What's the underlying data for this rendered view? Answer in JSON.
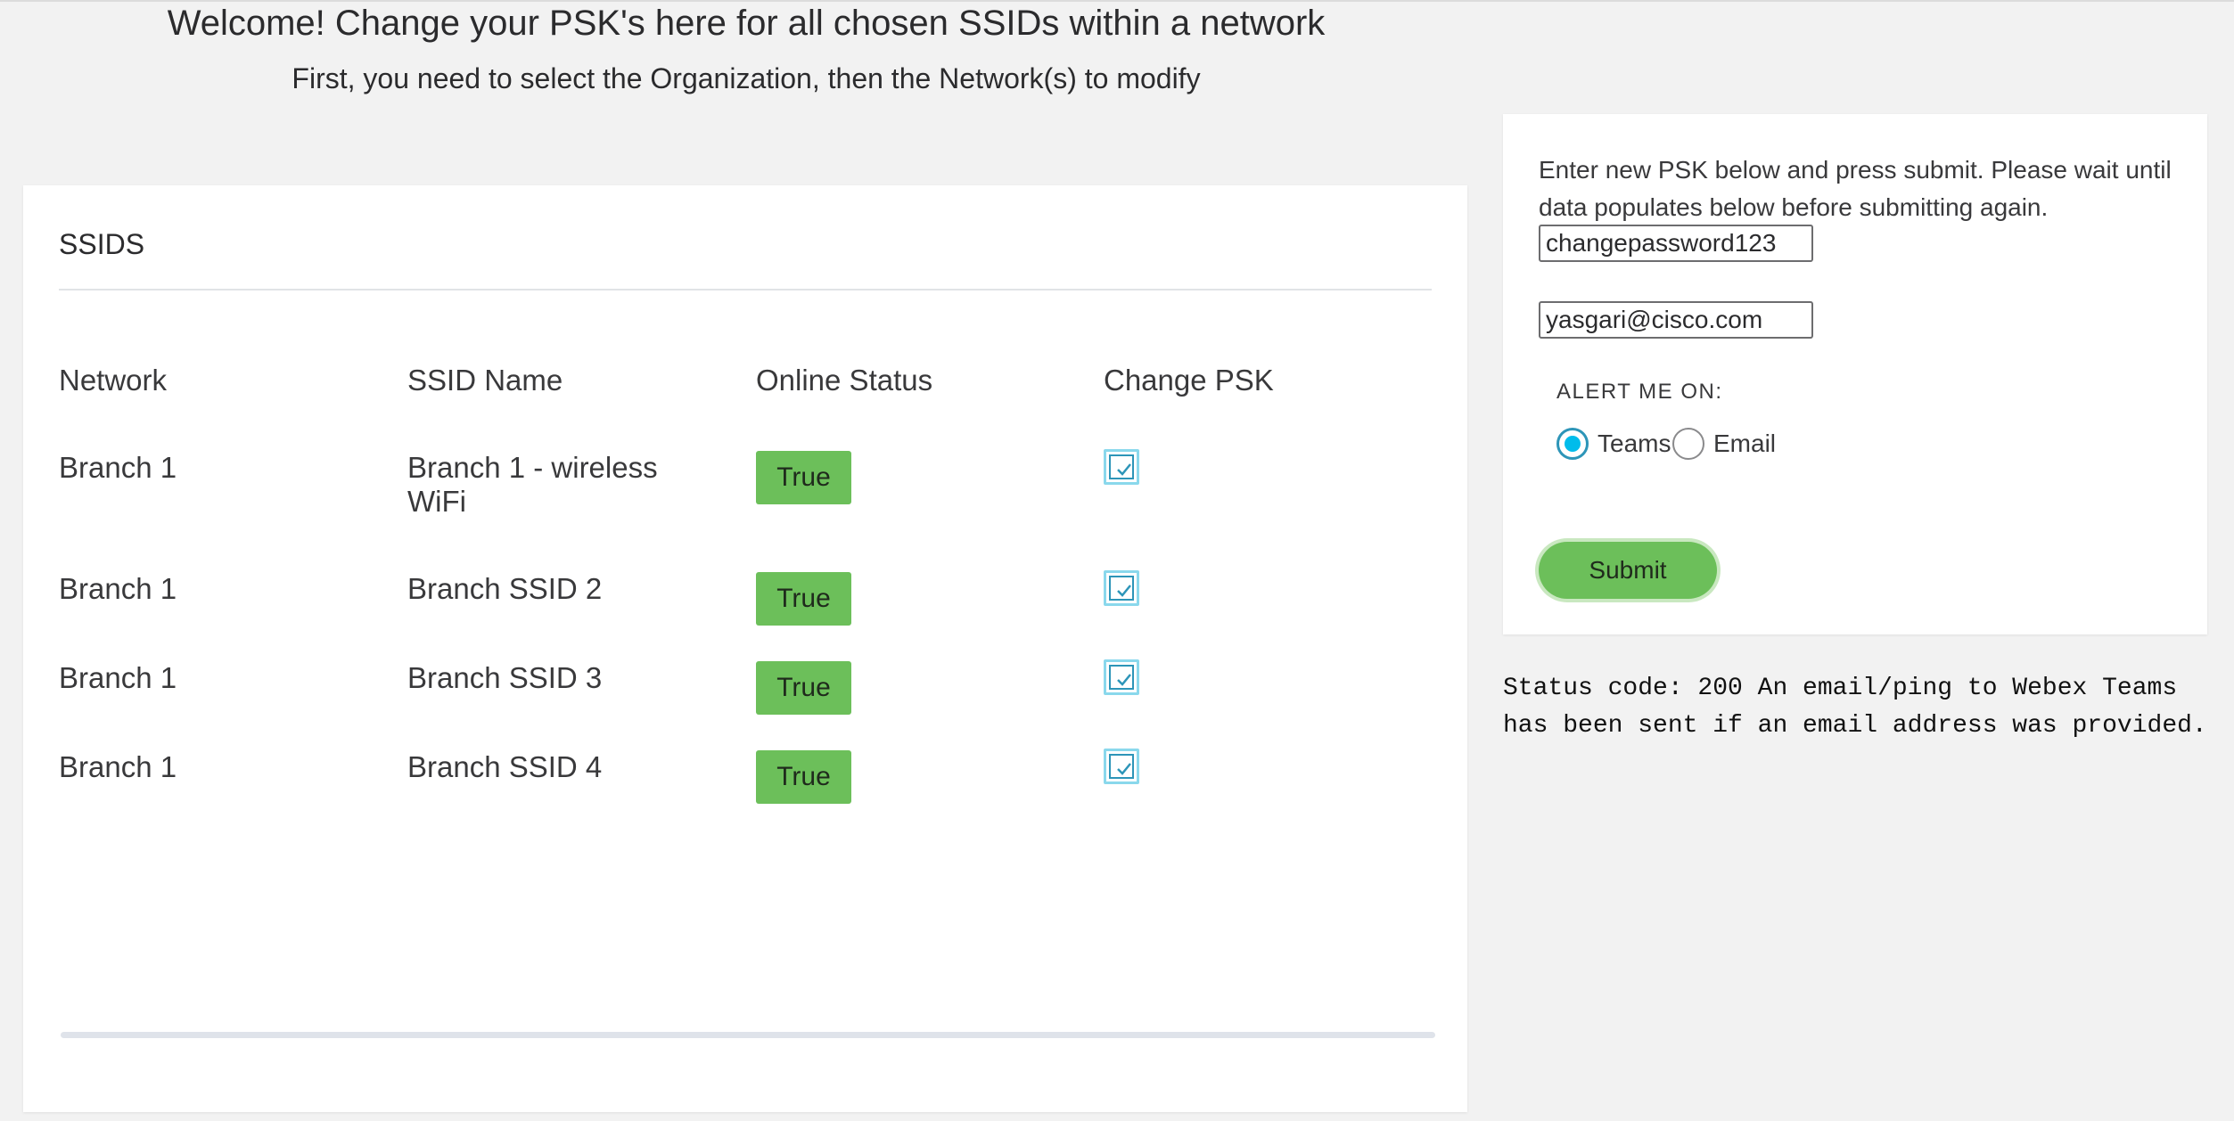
{
  "header": {
    "welcome": "Welcome! Change your PSK's here for all chosen SSIDs within a network",
    "subtitle": "First, you need to select the Organization, then the Network(s) to modify"
  },
  "ssids_card": {
    "title": "SSIDS",
    "columns": [
      "Network",
      "SSID Name",
      "Online Status",
      "Change PSK"
    ],
    "rows": [
      {
        "network": "Branch 1",
        "ssid_line1": "Branch 1 - wireless",
        "ssid_line2": "WiFi",
        "status": "True",
        "change_psk": true
      },
      {
        "network": "Branch 1",
        "ssid_line1": "Branch SSID 2",
        "ssid_line2": "",
        "status": "True",
        "change_psk": true
      },
      {
        "network": "Branch 1",
        "ssid_line1": "Branch SSID 3",
        "ssid_line2": "",
        "status": "True",
        "change_psk": true
      },
      {
        "network": "Branch 1",
        "ssid_line1": "Branch SSID 4",
        "ssid_line2": "",
        "status": "True",
        "change_psk": true
      }
    ]
  },
  "psk_form": {
    "instructions": "Enter new PSK below and press submit. Please wait until data populates below before submitting again.",
    "psk_value": "changepassword123",
    "email_value": "yasgari@cisco.com",
    "alert_label": "ALERT ME ON:",
    "alert_options": [
      "Teams",
      "Email"
    ],
    "alert_selected": "Teams",
    "submit_label": "Submit"
  },
  "status_message": "Status code: 200 An email/ping to Webex Teams has been sent if an email address was provided.",
  "colors": {
    "background": "#f2f2f2",
    "badge_green": "#6cbf5a",
    "radio_accent": "#00bceb",
    "checkbox_accent": "#2d95b8"
  }
}
